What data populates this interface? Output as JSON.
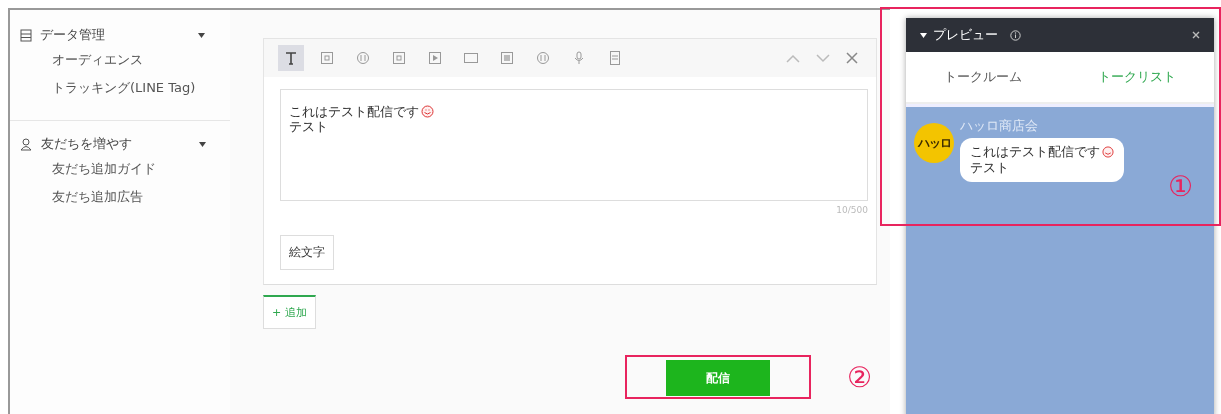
{
  "sidebar": {
    "sections": [
      {
        "kind": "data",
        "label": "データ管理",
        "expanded": true,
        "items": [
          "オーディエンス",
          "トラッキング(LINE Tag)"
        ]
      },
      {
        "kind": "friends",
        "label": "友だちを増やす",
        "expanded": true,
        "items": [
          "友だち追加ガイド",
          "友だち追加広告"
        ]
      }
    ]
  },
  "editor": {
    "toolbar": [
      {
        "kind": "text",
        "selected": true
      },
      {
        "kind": "image",
        "selected": false
      },
      {
        "kind": "sticker",
        "selected": false
      },
      {
        "kind": "coupon",
        "selected": false
      },
      {
        "kind": "video",
        "selected": false
      },
      {
        "kind": "card",
        "selected": false
      },
      {
        "kind": "rich",
        "selected": false
      },
      {
        "kind": "survey",
        "selected": false
      },
      {
        "kind": "voice",
        "selected": false
      },
      {
        "kind": "file",
        "selected": false
      }
    ],
    "lines": [
      "これはテスト配信です",
      "テスト"
    ],
    "counter": "10/500",
    "emoji_button": "絵文字"
  },
  "add_button": "+ 追加",
  "send_button": "配信",
  "preview": {
    "title": "プレビュー",
    "tabs": [
      {
        "label": "トークルーム",
        "selected": false
      },
      {
        "label": "トークリスト",
        "selected": true
      }
    ],
    "account_name": "ハッロ商店会",
    "avatar_text": "ハッロ",
    "bubble_lines": [
      "これはテスト配信です",
      "テスト"
    ]
  },
  "annotations": [
    "①",
    "②"
  ]
}
